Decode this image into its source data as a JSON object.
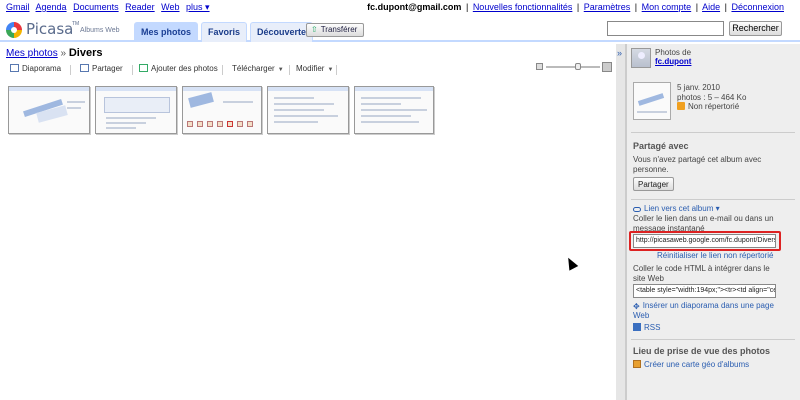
{
  "gbar": {
    "links": [
      "Gmail",
      "Agenda",
      "Documents",
      "Reader",
      "Web",
      "plus ▾"
    ],
    "email": "fc.dupont@gmail.com",
    "account_links": [
      "Nouvelles fonctionnalités",
      "Paramètres",
      "Mon compte",
      "Aide",
      "Déconnexion"
    ]
  },
  "header": {
    "logo_name": "Picasa",
    "logo_tm": "TM",
    "logo_subtitle": "Albums Web",
    "tabs": [
      "Mes photos",
      "Favoris",
      "Découverte"
    ],
    "upload_label": "Transférer",
    "search_placeholder": "",
    "search_button": "Rechercher"
  },
  "breadcrumb": {
    "root": "Mes photos",
    "separator": "»",
    "current": "Divers"
  },
  "toolbar": {
    "slideshow": "Diaporama",
    "share": "Partager",
    "add_photos": "Ajouter des photos",
    "download": "Télécharger",
    "edit": "Modifier"
  },
  "zoom_level": 0.6,
  "thumbnails": [
    "photo-1",
    "photo-2",
    "photo-3",
    "photo-4",
    "photo-5"
  ],
  "sidebar": {
    "toggle_icon": "»",
    "owner_label": "Photos de",
    "owner_name": "fc.dupont",
    "album_date": "5 janv. 2010",
    "album_stats": "photos : 5 – 464 Ko",
    "album_visibility": "Non répertorié",
    "shared_title": "Partagé avec",
    "shared_text": "Vous n'avez partagé cet album avec personne.",
    "share_button": "Partager",
    "link_label": "Lien vers cet album ▾",
    "link_instructions": "Coller le lien dans un e-mail ou dans un message instantané",
    "link_url": "http://picasaweb.google.com/fc.dupont/Divers",
    "reset_link": "Réinitialiser le lien non répertorié",
    "embed_instructions": "Coller le code HTML à intégrer dans le site Web",
    "embed_code": "<table style=\"width:194px;\"><tr><td align=\"ce",
    "embed_slideshow": "Insérer un diaporama dans une page Web",
    "rss": "RSS",
    "location_title": "Lieu de prise de vue des photos",
    "create_map": "Créer une carte géo d'albums"
  },
  "colors": {
    "tab_bg": "#c3d9ff",
    "link": "#0000cc",
    "highlight_box": "#dd2222",
    "sidebar_bg": "#eeeeee"
  }
}
